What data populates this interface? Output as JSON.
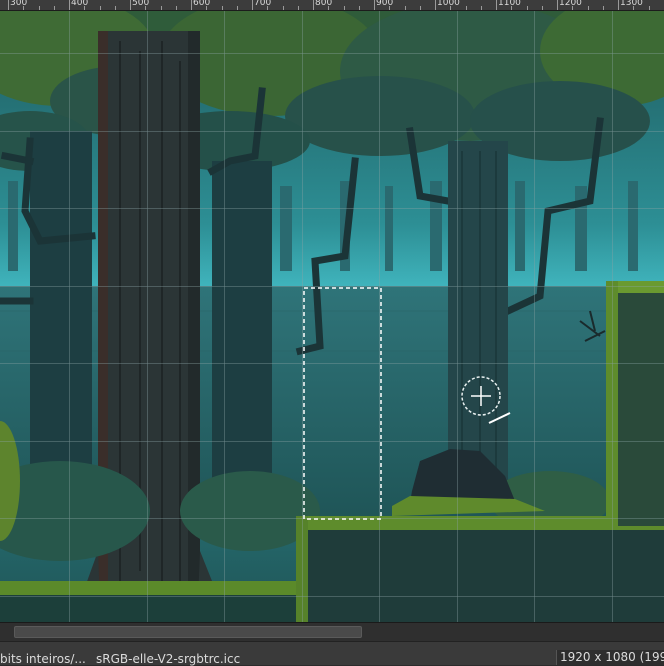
{
  "ruler": {
    "labels": [
      "300",
      "400",
      "500",
      "600",
      "700",
      "800",
      "900",
      "1000",
      "1100",
      "1200",
      "1300"
    ]
  },
  "canvas": {
    "grid": true,
    "selection_tool": "rectangle-select",
    "cursor": "move-crosshair-icon",
    "colors": {
      "sky_glow": "#4fd3e0",
      "water": "#2d6e73",
      "bark": "#2a3a3c",
      "foliage": "#4f7a2a",
      "moss": "#7a9a35",
      "grid_line": "#8aa2a4",
      "selection": "#ffffff"
    }
  },
  "statusbar": {
    "left_text": "bits inteiros/...",
    "profile": "sRGB-elle-V2-srgbtrc.icc",
    "dimensions": "1920 x 1080 (199"
  }
}
